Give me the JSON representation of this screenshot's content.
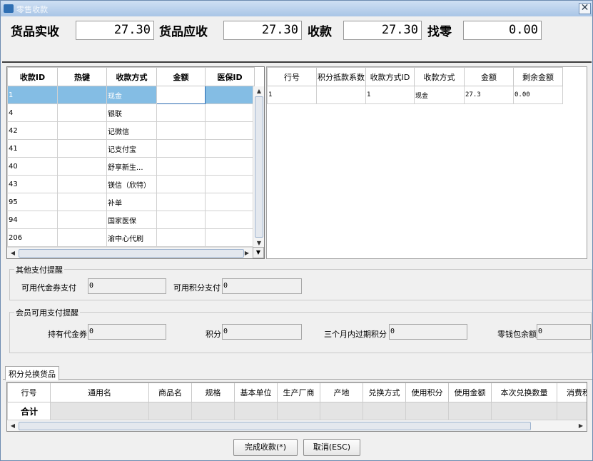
{
  "window": {
    "title": "零售收款",
    "close_glyph": "✕"
  },
  "summary": {
    "actual_label": "货品实收",
    "actual_value": "27.30",
    "due_label": "货品应收",
    "due_value": "27.30",
    "received_label": "收款",
    "received_value": "27.30",
    "change_label": "找零",
    "change_value": "0.00"
  },
  "payment_methods": {
    "headers": [
      "收款ID",
      "热键",
      "收款方式",
      "金额",
      "医保ID"
    ],
    "rows": [
      [
        "1",
        "",
        "现金",
        "",
        ""
      ],
      [
        "4",
        "",
        "银联",
        "",
        ""
      ],
      [
        "42",
        "",
        "记微信",
        "",
        ""
      ],
      [
        "41",
        "",
        "记支付宝",
        "",
        ""
      ],
      [
        "40",
        "",
        "舒享新生...",
        "",
        ""
      ],
      [
        "43",
        "",
        "镁信（欣特）",
        "",
        ""
      ],
      [
        "95",
        "",
        "补单",
        "",
        ""
      ],
      [
        "94",
        "",
        "国家医保",
        "",
        ""
      ],
      [
        "206",
        "",
        "渝中心代刷",
        "",
        ""
      ]
    ],
    "selected_row": 0
  },
  "payment_lines": {
    "headers": [
      "行号",
      "积分抵款系数",
      "收款方式ID",
      "收款方式",
      "金额",
      "剩余金额"
    ],
    "rows": [
      [
        "1",
        "",
        "1",
        "现金",
        "27.3",
        "0.00"
      ]
    ]
  },
  "other_pay": {
    "legend": "其他支付提醒",
    "voucher_label": "可用代金券支付",
    "voucher_value": "0",
    "points_label": "可用积分支付",
    "points_value": "0"
  },
  "member_pay": {
    "legend": "会员可用支付提醒",
    "held_voucher_label": "持有代金券",
    "held_voucher_value": "0",
    "points_label": "积分",
    "points_value": "0",
    "expiring_label": "三个月内过期积分",
    "expiring_value": "0",
    "wallet_label": "零钱包余额",
    "wallet_value": "0"
  },
  "tab": {
    "label": "积分兑换货品"
  },
  "exchange": {
    "headers": [
      "行号",
      "通用名",
      "商品名",
      "规格",
      "基本单位",
      "生产厂商",
      "产地",
      "兑换方式",
      "使用积分",
      "使用金额",
      "本次兑换数量",
      "消费积"
    ],
    "total_label": "合计"
  },
  "buttons": {
    "finish": "完成收款(*)",
    "cancel": "取消(ESC)"
  },
  "icons": {
    "scroll_up": "▲",
    "scroll_down": "▼",
    "scroll_left": "◀",
    "scroll_right": "▶",
    "grip": "|||"
  }
}
